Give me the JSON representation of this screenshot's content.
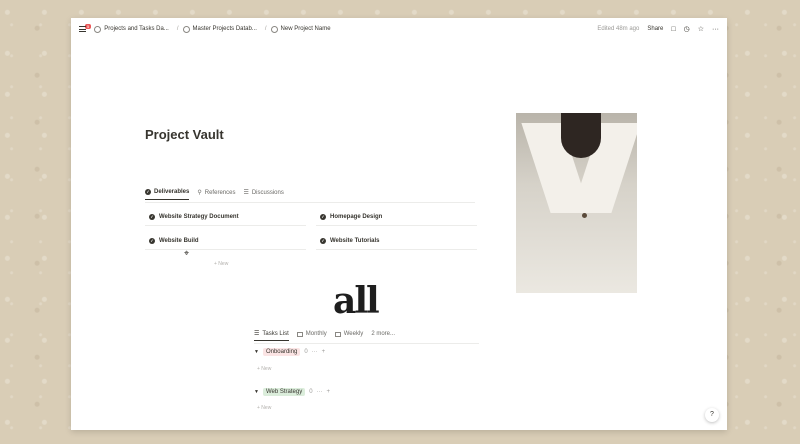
{
  "breadcrumbs": [
    {
      "label": "Projects and Tasks Da...",
      "badge": "5"
    },
    {
      "label": "Master Projects Datab..."
    },
    {
      "label": "New Project Name"
    }
  ],
  "topbar": {
    "edited": "Edited 48m ago",
    "share": "Share",
    "icons": [
      "comment-icon",
      "clock-icon",
      "star-icon",
      "more-icon"
    ]
  },
  "page": {
    "title": "Project Vault"
  },
  "tabs": [
    {
      "label": "Deliverables",
      "icon": "check-circle-icon"
    },
    {
      "label": "References",
      "icon": "search-icon"
    },
    {
      "label": "Discussions",
      "icon": "list-icon"
    }
  ],
  "cards": [
    {
      "label": "Website Strategy Document"
    },
    {
      "label": "Homepage Design"
    },
    {
      "label": "Website Build"
    },
    {
      "label": "Website Tutorials"
    }
  ],
  "new_label": "+ New",
  "brand_text": "all",
  "view_tabs": [
    {
      "label": "Tasks List"
    },
    {
      "label": "Monthly"
    },
    {
      "label": "Weekly"
    },
    {
      "label": "2 more..."
    }
  ],
  "groups": [
    {
      "label": "Onboarding",
      "count": "0",
      "new": "+ New",
      "color": "#fbe4e4"
    },
    {
      "label": "Web Strategy",
      "count": "0",
      "new": "+ New",
      "color": "#dbeddb"
    }
  ],
  "help": "?"
}
